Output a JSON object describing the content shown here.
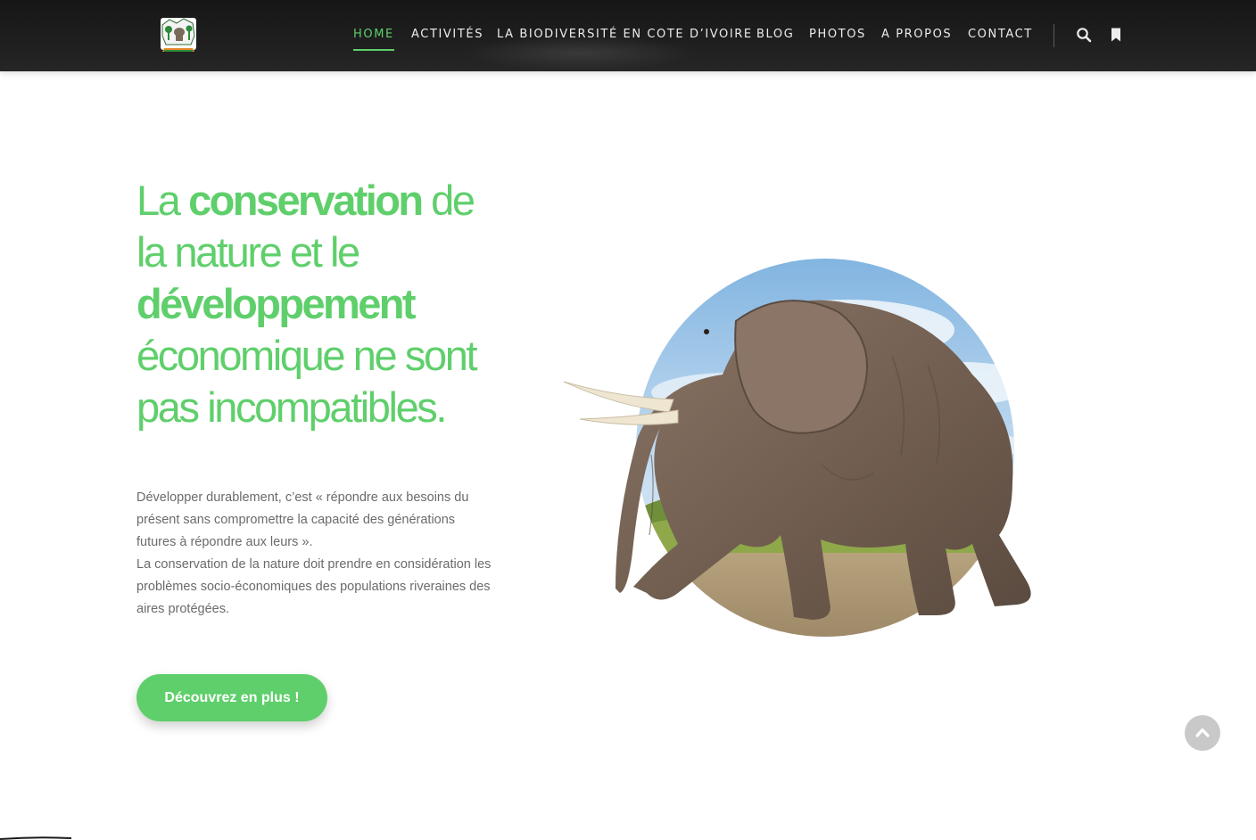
{
  "header": {
    "logo_alt": "Logo",
    "nav": [
      {
        "label": "HOME",
        "active": true
      },
      {
        "label": "ACTIVITÉS"
      },
      {
        "label": "LA BIODIVERSITÉ EN COTE D’IVOIRE"
      },
      {
        "label": "BLOG"
      },
      {
        "label": "PHOTOS"
      },
      {
        "label": "A PROPOS"
      },
      {
        "label": "CONTACT"
      }
    ],
    "icons": [
      "search-icon",
      "bookmark-icon"
    ]
  },
  "hero": {
    "headline": {
      "part1": "La ",
      "strong1": "conservation",
      "part2": " de la nature et le ",
      "strong2": "développement",
      "part3": " économique ne sont pas incompatibles."
    },
    "paragraph_line1": "Développer durablement, c’est « répondre aux besoins du présent sans compromettre la capacité des générations futures à répondre aux leurs ».",
    "paragraph_line2": "La conservation de la nature doit prendre en considération les problèmes socio-économiques des populations riveraines des aires protégées.",
    "cta_label": "Découvrez en plus !"
  },
  "colors": {
    "accent": "#5fcf6b",
    "header_bg": "#1c1c1c",
    "text_muted": "#6b6b6b"
  },
  "illustration": "elephant-in-circle"
}
